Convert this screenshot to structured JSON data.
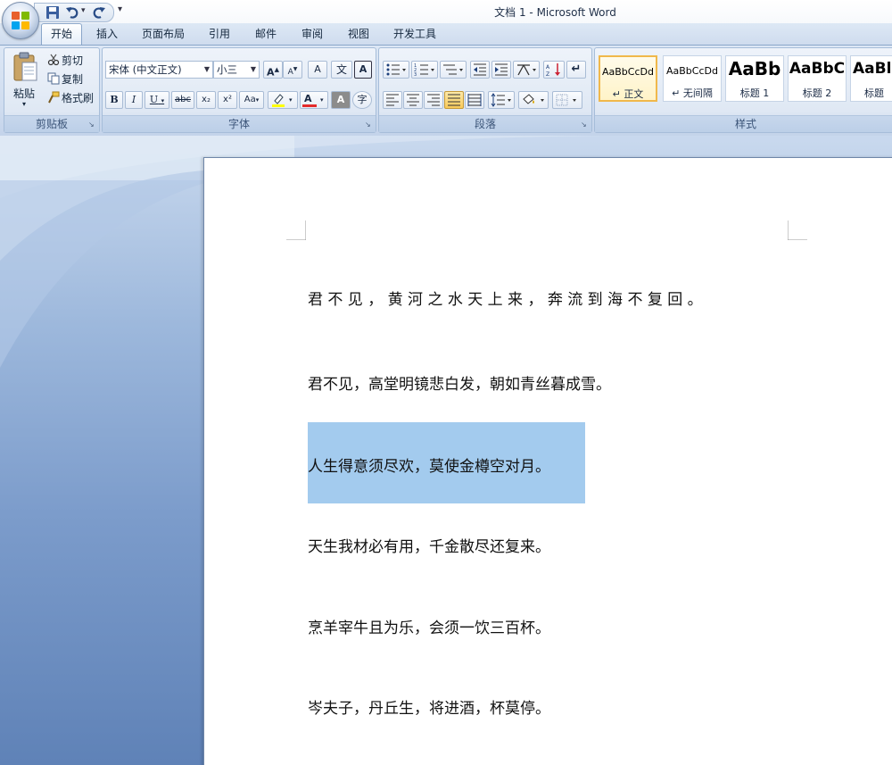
{
  "window": {
    "title": "文档 1 - Microsoft Word"
  },
  "quick_access": {
    "more": "▾"
  },
  "tabs": [
    {
      "label": "开始",
      "active": true
    },
    {
      "label": "插入"
    },
    {
      "label": "页面布局"
    },
    {
      "label": "引用"
    },
    {
      "label": "邮件"
    },
    {
      "label": "审阅"
    },
    {
      "label": "视图"
    },
    {
      "label": "开发工具"
    }
  ],
  "clipboard": {
    "group_label": "剪贴板",
    "paste": "粘贴",
    "cut": "剪切",
    "copy": "复制",
    "format_painter": "格式刷"
  },
  "font": {
    "group_label": "字体",
    "family": "宋体 (中文正文)",
    "size": "小三",
    "bold": "B",
    "italic": "I",
    "underline": "U",
    "strike": "abc",
    "subscript": "x₂",
    "superscript": "x²",
    "change_case": "Aa",
    "grow": "A",
    "shrink": "A",
    "clear": "A",
    "font_color": "A",
    "char_shading": "A",
    "enclose": "字",
    "phonetic": "文",
    "char_border": "A"
  },
  "paragraph": {
    "group_label": "段落"
  },
  "styles": {
    "group_label": "样式",
    "items": [
      {
        "sample": "AaBbCcDd",
        "name": "↵ 正文",
        "selected": true
      },
      {
        "sample": "AaBbCcDd",
        "name": "↵ 无间隔"
      },
      {
        "sample": "AaBb",
        "name": "标题 1"
      },
      {
        "sample": "AaBbC",
        "name": "标题 2"
      },
      {
        "sample": "AaBl",
        "name": "标题"
      }
    ]
  },
  "document": {
    "lines": [
      "君 不 见 ， 黄 河 之 水 天 上 来 ， 奔 流 到 海 不 复 回 。",
      "君不见，高堂明镜悲白发，朝如青丝暮成雪。",
      "人生得意须尽欢，莫使金樽空对月。",
      "天生我材必有用，千金散尽还复来。",
      "烹羊宰牛且为乐，会须一饮三百杯。",
      "岑夫子，丹丘生，将进酒，杯莫停。"
    ],
    "selected_line": 2,
    "selection_color": "#a3cbee"
  }
}
